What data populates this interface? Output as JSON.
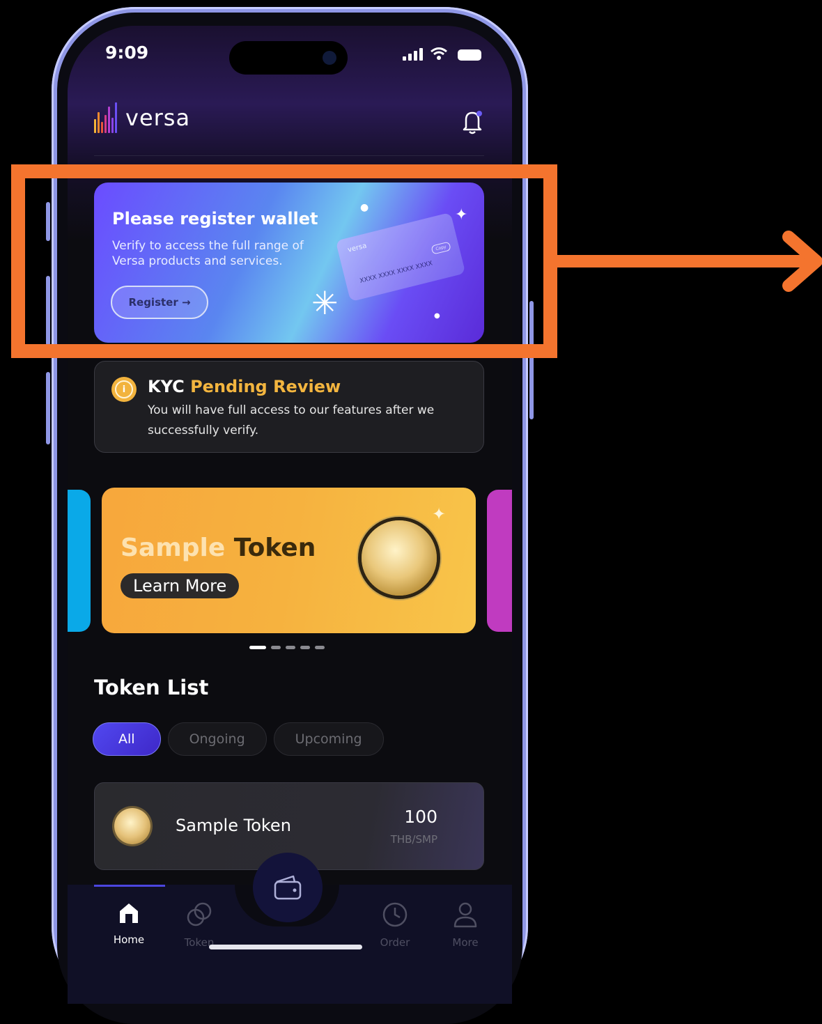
{
  "status_bar": {
    "time": "9:09"
  },
  "app": {
    "brand": "versa"
  },
  "register_card": {
    "title": "Please register wallet",
    "subtitle": "Verify to access the full range of  Versa products and services.",
    "button_label": "Register →",
    "mini_card_brand": "versa",
    "mini_card_number": "XXXX XXXX XXXX XXXX",
    "mini_card_copy": "Copy"
  },
  "kyc": {
    "title_prefix": "KYC",
    "title_status": "Pending Review",
    "message": "You will have full access to our features after we successfully verify."
  },
  "banner": {
    "title_part1": "Sample",
    "title_part2": " Token",
    "button_label": "Learn More",
    "page_count": 5,
    "active_page": 1
  },
  "token_list": {
    "title": "Token List",
    "filters": [
      "All",
      "Ongoing",
      "Upcoming"
    ],
    "active_filter": "All",
    "items": [
      {
        "name": "Sample Token",
        "value": "100",
        "unit": "THB/SMP"
      }
    ]
  },
  "nav": {
    "items": [
      {
        "label": "Home",
        "icon": "home-icon",
        "active": true
      },
      {
        "label": "Token",
        "icon": "token-icon",
        "active": false
      },
      {
        "label": "Order",
        "icon": "clock-icon",
        "active": false
      },
      {
        "label": "More",
        "icon": "user-icon",
        "active": false
      }
    ],
    "center_icon": "wallet-icon"
  },
  "colors": {
    "accent": "#4b46e0",
    "warning": "#f3b53f",
    "highlight": "#f4742e",
    "banner": "#f7b13f"
  }
}
